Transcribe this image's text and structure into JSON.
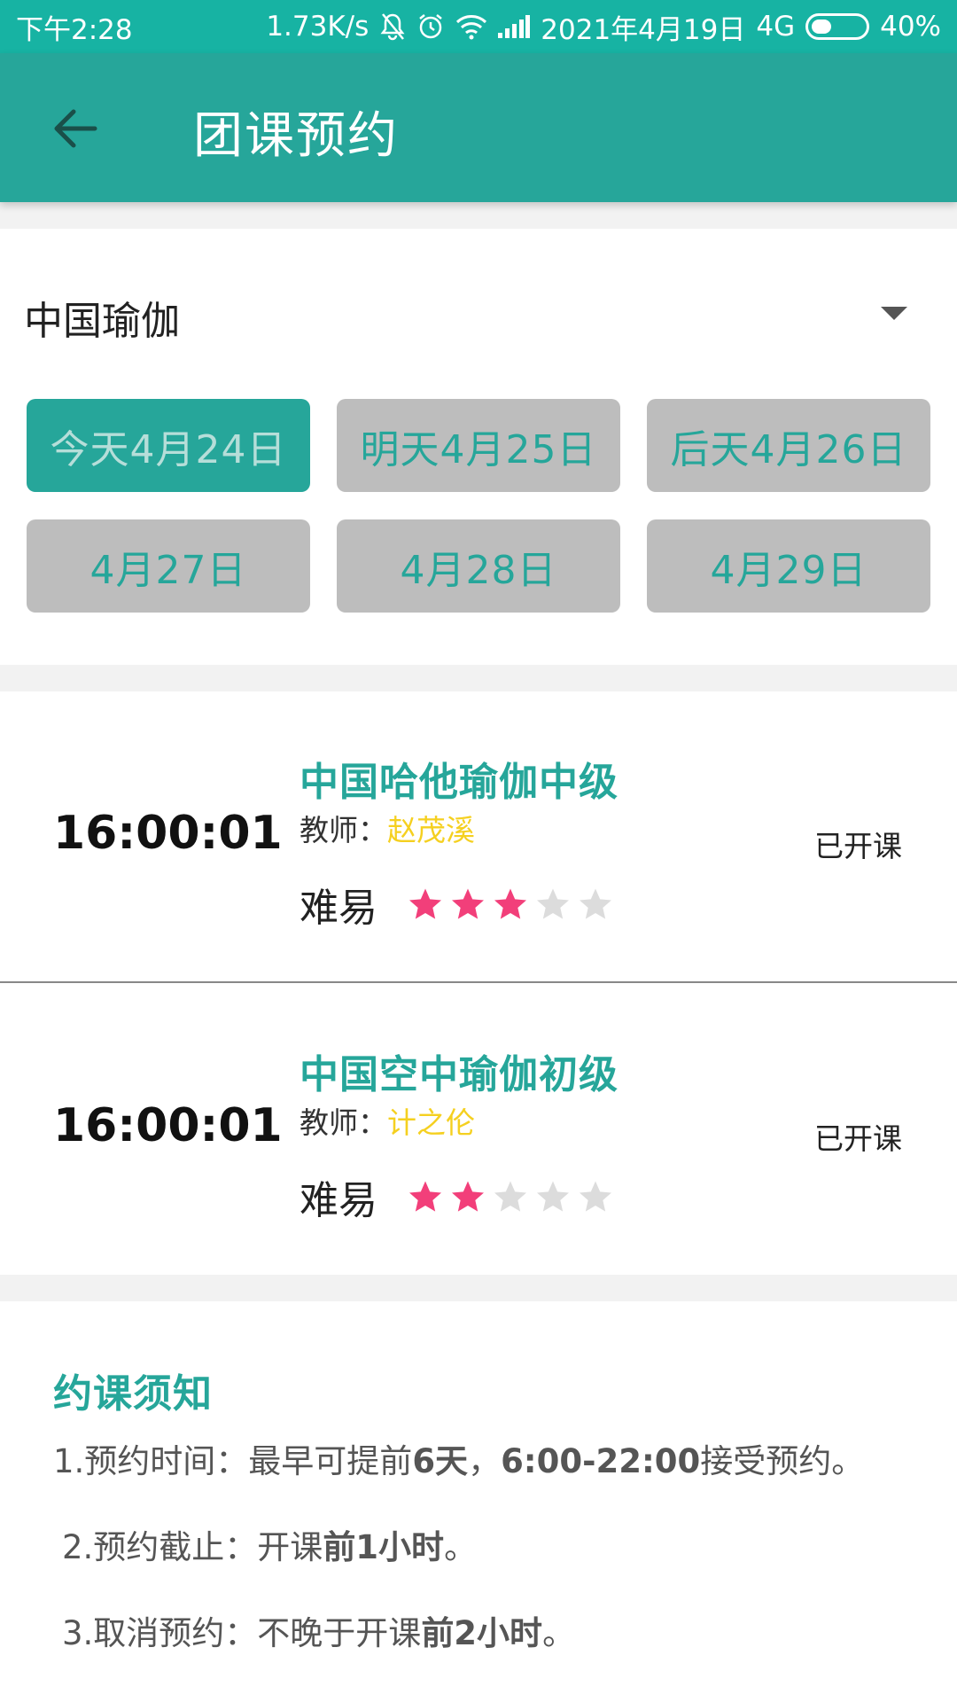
{
  "status_bar": {
    "time": "下午2:28",
    "net_speed": "1.73K/s",
    "date": "2021年4月19日",
    "network": "4G",
    "battery": "40%",
    "battery_level": 0.4
  },
  "app_bar": {
    "title": "团课预约",
    "back_icon": "arrow-back-icon"
  },
  "selector": {
    "category": "中国瑜伽",
    "dropdown_icon": "dropdown-triangle-icon",
    "dates": [
      {
        "label": "今天4月24日",
        "active": true
      },
      {
        "label": "明天4月25日",
        "active": false
      },
      {
        "label": "后天4月26日",
        "active": false
      },
      {
        "label": "4月27日",
        "active": false
      },
      {
        "label": "4月28日",
        "active": false
      },
      {
        "label": "4月29日",
        "active": false
      }
    ]
  },
  "courses": [
    {
      "time": "16:00:01",
      "name": "中国哈他瑜伽中级",
      "teacher_label": "教师：",
      "teacher": "赵茂溪",
      "difficulty_label": "难易",
      "rating": 3,
      "rating_max": 5,
      "status": "已开课"
    },
    {
      "time": "16:00:01",
      "name": "中国空中瑜伽初级",
      "teacher_label": "教师：",
      "teacher": "计之伦",
      "difficulty_label": "难易",
      "rating": 2,
      "rating_max": 5,
      "status": "已开课"
    }
  ],
  "colors": {
    "primary": "#26a69a",
    "status_bar": "#17b3a3",
    "star_on": "#f23f7a",
    "star_off": "#dcdcdc",
    "teacher_name": "#f5d020"
  },
  "notice": {
    "title": "约课须知",
    "line1": {
      "a": "1.预约时间：最早可提前",
      "b": "6天",
      "c": "，",
      "d": "6:00-22:00",
      "e": "接受预约。"
    },
    "line2": {
      "a": "2.预约截止：开课",
      "b": "前1小时",
      "c": "。"
    },
    "line3": {
      "a": "3.取消预约：不晚于开课",
      "b": "前2小时",
      "c": "。"
    }
  }
}
